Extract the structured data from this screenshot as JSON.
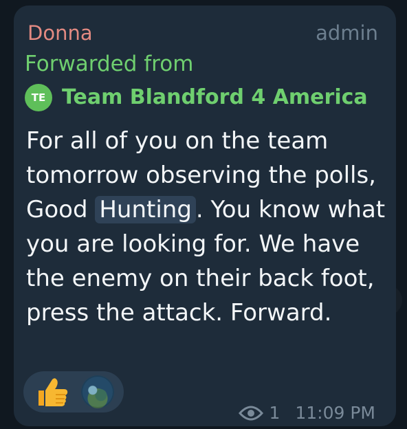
{
  "message": {
    "sender": "Donna",
    "role": "admin",
    "forwarded_label": "Forwarded from",
    "source": {
      "avatar_initials": "TE",
      "name": "Team Blandford 4 America"
    },
    "text_before": "For all of you on the team tomorrow observing the polls, Good ",
    "highlighted": "Hunting",
    "text_after": ".  You know what you are looking for.  We have the enemy on their back foot, press the attack.  Forward.",
    "reactions": [
      {
        "icon": "thumbs-up-emoji"
      }
    ],
    "views": "1",
    "time": "11:09 PM"
  },
  "colors": {
    "bubble": "#1e2c3a",
    "sender": "#e38a82",
    "forward": "#6fcf6f",
    "meta": "#7a8a99",
    "text": "#f3f6f8"
  }
}
